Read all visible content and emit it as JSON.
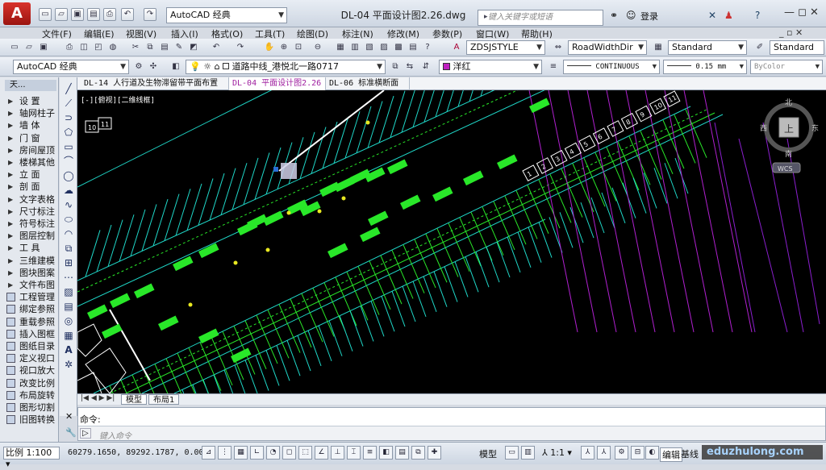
{
  "app": {
    "logo_letter": "A",
    "workspace": "AutoCAD 经典",
    "document_title": "DL-04 平面设计图2.26.dwg",
    "search_placeholder": "键入关键字或短语",
    "signin_label": "登录",
    "window_controls": "— ◻ ✕"
  },
  "menu": [
    "文件(F)",
    "编辑(E)",
    "视图(V)",
    "插入(I)",
    "格式(O)",
    "工具(T)",
    "绘图(D)",
    "标注(N)",
    "修改(M)",
    "参数(P)",
    "窗口(W)",
    "帮助(H)"
  ],
  "toolbar2": {
    "text_style": "ZDSJSTYLE",
    "dim_style": "RoadWidthDir",
    "table_style": "Standard",
    "mleader_style": "Standard"
  },
  "toolbar3": {
    "workspace": "AutoCAD 经典",
    "layer": "道路中线_港悦北一路0717",
    "color": "洋红",
    "linetype": "CONTINUOUS",
    "lineweight": "0.15 mm",
    "plotstyle": "ByColor"
  },
  "left_panel": {
    "header": "天...",
    "items": [
      "设  置",
      "轴网柱子",
      "墙  体",
      "门  窗",
      "房间屋顶",
      "楼梯其他",
      "立  面",
      "剖  面",
      "文字表格",
      "尺寸标注",
      "符号标注",
      "图层控制",
      "工  具",
      "三维建模",
      "图块图案",
      "文件布图",
      "工程管理",
      "绑定参照",
      "重载参照",
      "插入图框",
      "图纸目录",
      "定义视口",
      "视口放大",
      "改变比例",
      "布局旋转",
      "图形切割",
      "旧图转换"
    ]
  },
  "doc_tabs": [
    "DL-14 人行道及生物滞留带平面布置图",
    "DL-04 平面设计图2.26",
    "DL-06 标准横断面图"
  ],
  "viewport_label": "[-][俯视][二维线框]",
  "viewcube": {
    "top": "上",
    "north": "北",
    "south": "南",
    "east": "东",
    "west": "西",
    "wcs": "WCS"
  },
  "station_labels": [
    "1",
    "2",
    "3",
    "4",
    "5",
    "6",
    "7",
    "8",
    "9",
    "10",
    "11"
  ],
  "left_station_labels": [
    "10",
    "11"
  ],
  "layout_tabs": [
    "模型",
    "布局1"
  ],
  "command": {
    "history": "命令:",
    "placeholder": "键入命令"
  },
  "status": {
    "scale": "比例 1:100",
    "coords": "60279.1650, 89292.1787, 0.0000",
    "model": "模型",
    "annot_scale": "1:1",
    "edit": "编辑",
    "baseline": "基线",
    "watermark": "eduzhulong.com"
  },
  "colors": {
    "canvas_bg": "#000000",
    "green_line": "#29e829",
    "cyan_line": "#1fd7c8",
    "magenta_line": "#b020d0",
    "white_line": "#ffffff",
    "active_tab": "#a020a0"
  }
}
